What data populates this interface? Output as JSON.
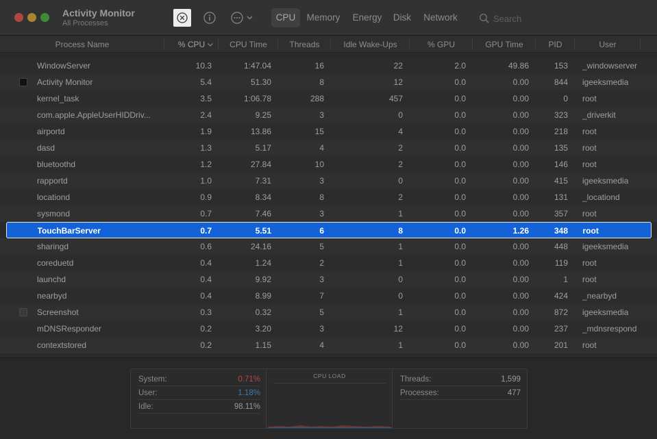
{
  "window": {
    "title": "Activity Monitor",
    "subtitle": "All Processes"
  },
  "toolbar": {
    "stop_icon": "x-circle-icon",
    "info_icon": "info-icon",
    "more_icon": "ellipsis-circle-icon",
    "tabs": [
      {
        "label": "CPU",
        "active": true
      },
      {
        "label": "Memory",
        "active": false
      },
      {
        "label": "Energy",
        "active": false
      },
      {
        "label": "Disk",
        "active": false
      },
      {
        "label": "Network",
        "active": false
      }
    ],
    "search": {
      "placeholder": "Search",
      "value": ""
    }
  },
  "table": {
    "columns": [
      "Process Name",
      "% CPU",
      "CPU Time",
      "Threads",
      "Idle Wake-Ups",
      "% GPU",
      "GPU Time",
      "PID",
      "User"
    ],
    "sort_column": "% CPU",
    "sort_direction": "descending",
    "rows": [
      {
        "name": "WindowServer",
        "cpu": "10.3",
        "cpu_time": "1:47.04",
        "threads": "16",
        "idle": "22",
        "gpu": "2.0",
        "gpu_time": "49.86",
        "pid": "153",
        "user": "_windowserver",
        "icon": "",
        "selected": false
      },
      {
        "name": "Activity Monitor",
        "cpu": "5.4",
        "cpu_time": "51.30",
        "threads": "8",
        "idle": "12",
        "gpu": "0.0",
        "gpu_time": "0.00",
        "pid": "844",
        "user": "igeeksmedia",
        "icon": "activity-monitor-app-icon",
        "selected": false
      },
      {
        "name": "kernel_task",
        "cpu": "3.5",
        "cpu_time": "1:06.78",
        "threads": "288",
        "idle": "457",
        "gpu": "0.0",
        "gpu_time": "0.00",
        "pid": "0",
        "user": "root",
        "icon": "",
        "selected": false
      },
      {
        "name": "com.apple.AppleUserHIDDriv...",
        "cpu": "2.4",
        "cpu_time": "9.25",
        "threads": "3",
        "idle": "0",
        "gpu": "0.0",
        "gpu_time": "0.00",
        "pid": "323",
        "user": "_driverkit",
        "icon": "",
        "selected": false
      },
      {
        "name": "airportd",
        "cpu": "1.9",
        "cpu_time": "13.86",
        "threads": "15",
        "idle": "4",
        "gpu": "0.0",
        "gpu_time": "0.00",
        "pid": "218",
        "user": "root",
        "icon": "",
        "selected": false
      },
      {
        "name": "dasd",
        "cpu": "1.3",
        "cpu_time": "5.17",
        "threads": "4",
        "idle": "2",
        "gpu": "0.0",
        "gpu_time": "0.00",
        "pid": "135",
        "user": "root",
        "icon": "",
        "selected": false
      },
      {
        "name": "bluetoothd",
        "cpu": "1.2",
        "cpu_time": "27.84",
        "threads": "10",
        "idle": "2",
        "gpu": "0.0",
        "gpu_time": "0.00",
        "pid": "146",
        "user": "root",
        "icon": "",
        "selected": false
      },
      {
        "name": "rapportd",
        "cpu": "1.0",
        "cpu_time": "7.31",
        "threads": "3",
        "idle": "0",
        "gpu": "0.0",
        "gpu_time": "0.00",
        "pid": "415",
        "user": "igeeksmedia",
        "icon": "",
        "selected": false
      },
      {
        "name": "locationd",
        "cpu": "0.9",
        "cpu_time": "8.34",
        "threads": "8",
        "idle": "2",
        "gpu": "0.0",
        "gpu_time": "0.00",
        "pid": "131",
        "user": "_locationd",
        "icon": "",
        "selected": false
      },
      {
        "name": "sysmond",
        "cpu": "0.7",
        "cpu_time": "7.46",
        "threads": "3",
        "idle": "1",
        "gpu": "0.0",
        "gpu_time": "0.00",
        "pid": "357",
        "user": "root",
        "icon": "",
        "selected": false
      },
      {
        "name": "TouchBarServer",
        "cpu": "0.7",
        "cpu_time": "5.51",
        "threads": "6",
        "idle": "8",
        "gpu": "0.0",
        "gpu_time": "1.26",
        "pid": "348",
        "user": "root",
        "icon": "",
        "selected": true
      },
      {
        "name": "sharingd",
        "cpu": "0.6",
        "cpu_time": "24.16",
        "threads": "5",
        "idle": "1",
        "gpu": "0.0",
        "gpu_time": "0.00",
        "pid": "448",
        "user": "igeeksmedia",
        "icon": "",
        "selected": false
      },
      {
        "name": "coreduetd",
        "cpu": "0.4",
        "cpu_time": "1.24",
        "threads": "2",
        "idle": "1",
        "gpu": "0.0",
        "gpu_time": "0.00",
        "pid": "119",
        "user": "root",
        "icon": "",
        "selected": false
      },
      {
        "name": "launchd",
        "cpu": "0.4",
        "cpu_time": "9.92",
        "threads": "3",
        "idle": "0",
        "gpu": "0.0",
        "gpu_time": "0.00",
        "pid": "1",
        "user": "root",
        "icon": "",
        "selected": false
      },
      {
        "name": "nearbyd",
        "cpu": "0.4",
        "cpu_time": "8.99",
        "threads": "7",
        "idle": "0",
        "gpu": "0.0",
        "gpu_time": "0.00",
        "pid": "424",
        "user": "_nearbyd",
        "icon": "",
        "selected": false
      },
      {
        "name": "Screenshot",
        "cpu": "0.3",
        "cpu_time": "0.32",
        "threads": "5",
        "idle": "1",
        "gpu": "0.0",
        "gpu_time": "0.00",
        "pid": "872",
        "user": "igeeksmedia",
        "icon": "screenshot-app-icon",
        "selected": false
      },
      {
        "name": "mDNSResponder",
        "cpu": "0.2",
        "cpu_time": "3.20",
        "threads": "3",
        "idle": "12",
        "gpu": "0.0",
        "gpu_time": "0.00",
        "pid": "237",
        "user": "_mdnsrespond",
        "icon": "",
        "selected": false
      },
      {
        "name": "contextstored",
        "cpu": "0.2",
        "cpu_time": "1.15",
        "threads": "4",
        "idle": "1",
        "gpu": "0.0",
        "gpu_time": "0.00",
        "pid": "201",
        "user": "root",
        "icon": "",
        "selected": false
      }
    ]
  },
  "summary": {
    "system_label": "System:",
    "system_value": "0.71%",
    "user_label": "User:",
    "user_value": "1.18%",
    "idle_label": "Idle:",
    "idle_value": "98.11%",
    "graph_title": "CPU LOAD",
    "threads_label": "Threads:",
    "threads_value": "1,599",
    "processes_label": "Processes:",
    "processes_value": "477"
  },
  "colors": {
    "selection": "#1462d8",
    "system": "#b04a44",
    "user": "#3e7ca8"
  }
}
